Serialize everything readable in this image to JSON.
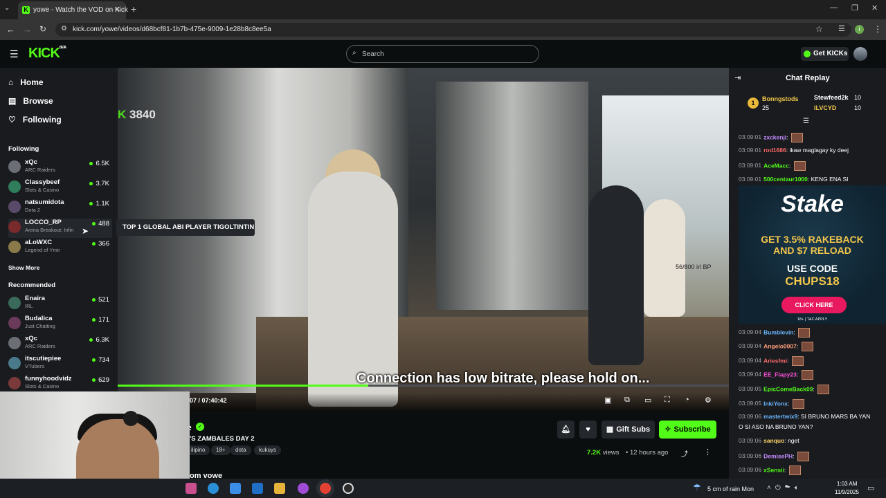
{
  "browser": {
    "tab_title": "yowe - Watch the VOD on Kick",
    "url": "kick.com/yowe/videos/d68bcf81-1b7b-475e-9009-1e28b8c8ee5a",
    "profile_initial": "i"
  },
  "kick": {
    "logo": "KICK",
    "logo_badge": "BETA",
    "search_placeholder": "Search",
    "get_kicks": "Get KICKs"
  },
  "sidebar": {
    "nav": [
      {
        "label": "Home",
        "icon": "home-icon"
      },
      {
        "label": "Browse",
        "icon": "browse-icon"
      },
      {
        "label": "Following",
        "icon": "heart-icon"
      }
    ],
    "following_header": "Following",
    "following": [
      {
        "name": "xQc",
        "category": "ARC Raiders",
        "viewers": "6.5K"
      },
      {
        "name": "Classybeef",
        "category": "Slots & Casino",
        "viewers": "3.7K"
      },
      {
        "name": "natsumidota",
        "category": "Dota 2",
        "viewers": "1.1K"
      },
      {
        "name": "LOCCO_RP",
        "category": "Arena Breakout: Infin",
        "viewers": "488"
      },
      {
        "name": "aLoWXC",
        "category": "Legend of Ymir",
        "viewers": "366"
      }
    ],
    "show_more": "Show More",
    "recommended_header": "Recommended",
    "recommended": [
      {
        "name": "Enaira",
        "category": "IRL",
        "viewers": "521"
      },
      {
        "name": "Budalica",
        "category": "Just Chatting",
        "viewers": "171"
      },
      {
        "name": "xQc",
        "category": "ARC Raiders",
        "viewers": "6.3K"
      },
      {
        "name": "itscutiepiee",
        "category": "VTubers",
        "viewers": "734"
      },
      {
        "name": "funnyhoodvidz",
        "category": "Slots & Casino",
        "viewers": "629"
      }
    ]
  },
  "tooltip": "TOP 1 GLOBAL ABI PLAYER TIGOLTINTIN",
  "video": {
    "overlay_score": "3840",
    "overlay_bp": "56/800 irl BP",
    "bitrate_message": "Connection has low bitrate, please hold on...",
    "time_current": "07",
    "time_total": "07:40:42",
    "progress": 0.41
  },
  "below": {
    "title": "'S ZAMBALES DAY 2",
    "name_partial": "e",
    "tags": [
      "ilipino",
      "18+",
      "dota",
      "kukuys"
    ],
    "gift_subs": "Gift Subs",
    "subscribe": "Subscribe",
    "views_count": "7.2K",
    "views_label": "views",
    "ago": "12 hours ago",
    "more_from": "om vowe"
  },
  "chat": {
    "header": "Chat Replay",
    "leaderboard": {
      "first": {
        "rank": "1",
        "name": "Bonngstods",
        "count": "25"
      },
      "second": {
        "name": "Stewfeed2k",
        "count": "10"
      },
      "third": {
        "name": "ILVCYD",
        "count": "10"
      }
    },
    "messages": [
      {
        "time": "03:09:01",
        "user": "zxckenji",
        "color": "#c48cff",
        "text": "",
        "emote": true
      },
      {
        "time": "03:09:01",
        "user": "rod1686",
        "color": "#ff6a6a",
        "text": "ikaw maglagay ky deej",
        "emote": false
      },
      {
        "time": "03:09:01",
        "user": "AceMacc",
        "color": "#53fc18",
        "text": "",
        "emote": true
      },
      {
        "time": "03:09:01",
        "user": "500centaur1000",
        "color": "#53fc18",
        "text": "KENG ENA SI",
        "emote": false
      },
      {
        "time": "03:09:04",
        "user": "Bumblevin",
        "color": "#6ab7ff",
        "text": "",
        "emote": true
      },
      {
        "time": "03:09:04",
        "user": "Angelo0007",
        "color": "#ff9c7a",
        "text": "",
        "emote": true
      },
      {
        "time": "03:09:04",
        "user": "Ariesfmi",
        "color": "#ff6a6a",
        "text": "",
        "emote": true
      },
      {
        "time": "03:09:04",
        "user": "EE_Flapy23",
        "color": "#ff4fd8",
        "text": "",
        "emote": true
      },
      {
        "time": "03:09:05",
        "user": "EpicComeBack09",
        "color": "#53fc18",
        "text": "",
        "emote": true
      },
      {
        "time": "03:09:05",
        "user": "InkiYonx",
        "color": "#6ab7ff",
        "text": "",
        "emote": true
      },
      {
        "time": "03:09:06",
        "user": "mastertwix9",
        "color": "#6ab7ff",
        "text": "SI BRUNO MARS BA YAN",
        "emote": false
      },
      {
        "time": "",
        "user": "",
        "color": "#ffffff",
        "text": "O SI ASO NA BRUNO YAN?",
        "emote": false
      },
      {
        "time": "03:09:06",
        "user": "sanquo",
        "color": "#ffd66a",
        "text": "nget",
        "emote": false
      },
      {
        "time": "03:09:06",
        "user": "DemisePH",
        "color": "#c48cff",
        "text": "",
        "emote": true
      },
      {
        "time": "03:09:06",
        "user": "xSensii",
        "color": "#53fc18",
        "text": "",
        "emote": true
      }
    ],
    "ad": {
      "brand": "Stake",
      "line1": "GET 3.5% RAKEBACK",
      "line2": "AND $7 RELOAD",
      "line3": "USE CODE",
      "code": "CHUPS18",
      "cta": "CLICK HERE",
      "disclaimer": "18+ | T&C APPLY"
    }
  },
  "taskbar": {
    "weather": "5 cm of rain Mon",
    "time": "1:03 AM",
    "date": "11/9/2025"
  },
  "colors": {
    "accent": "#53fc18",
    "bg": "#0b0e0f",
    "panel": "#191b1f"
  }
}
